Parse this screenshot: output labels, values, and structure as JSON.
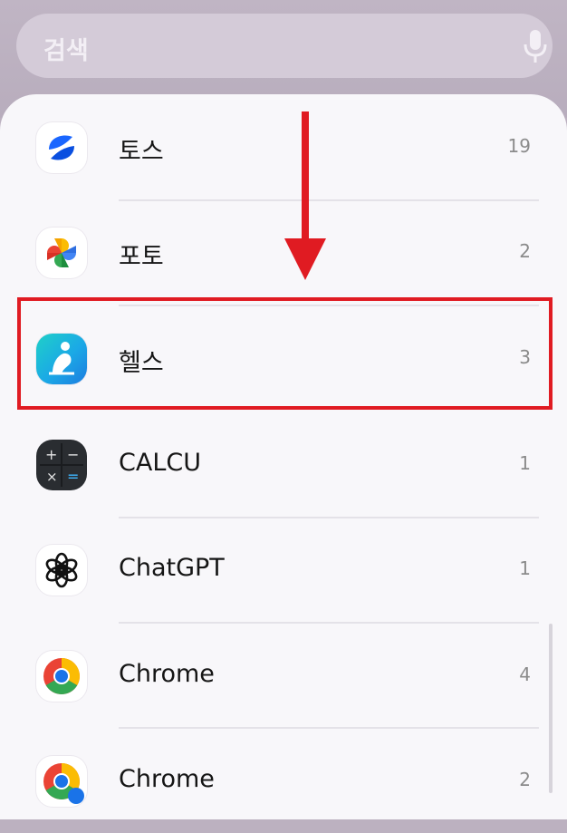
{
  "search": {
    "placeholder": "검색",
    "mic_icon": "microphone-icon"
  },
  "apps": [
    {
      "name": "토스",
      "count": "19",
      "icon": "toss-icon"
    },
    {
      "name": "포토",
      "count": "2",
      "icon": "photos-icon"
    },
    {
      "name": "헬스",
      "count": "3",
      "icon": "health-icon"
    },
    {
      "name": "CALCU",
      "count": "1",
      "icon": "calculator-icon"
    },
    {
      "name": "ChatGPT",
      "count": "1",
      "icon": "chatgpt-icon"
    },
    {
      "name": "Chrome",
      "count": "4",
      "icon": "chrome-icon"
    },
    {
      "name": "Chrome",
      "count": "2",
      "icon": "chrome-icon"
    }
  ],
  "annotation": {
    "highlighted_app": "헬스",
    "highlight_color": "#e01b22"
  }
}
